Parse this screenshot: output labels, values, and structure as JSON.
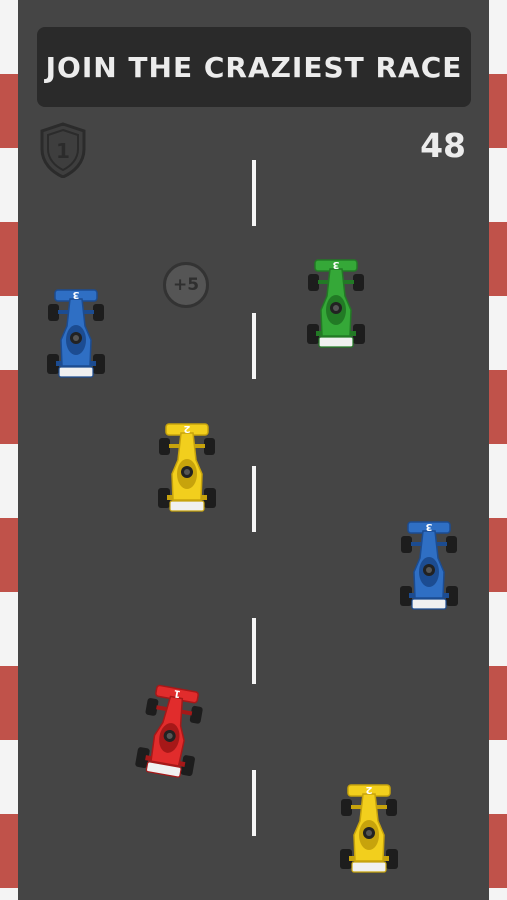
{
  "banner": {
    "text": "JOIN THE CRAZIEST RACE"
  },
  "hud": {
    "score": "48",
    "shield_label": "1",
    "bonus_label": "+5"
  },
  "colors": {
    "road": "#454545",
    "curb_red": "#c0524a",
    "curb_white": "#f4f4f4",
    "lane": "#f5f5f5"
  },
  "cars": [
    {
      "name": "blue-car-left",
      "color": "#2f6fc4",
      "dark": "#1c4c91",
      "number": "3",
      "icon": "race-car-icon"
    },
    {
      "name": "green-car",
      "color": "#35a838",
      "dark": "#227a25",
      "number": "3",
      "icon": "race-car-icon"
    },
    {
      "name": "yellow-car-middle",
      "color": "#f2cf1d",
      "dark": "#c7a30c",
      "number": "2",
      "icon": "race-car-icon"
    },
    {
      "name": "blue-car-right",
      "color": "#2f6fc4",
      "dark": "#1c4c91",
      "number": "3",
      "icon": "race-car-icon"
    },
    {
      "name": "red-car-player",
      "color": "#e12c2c",
      "dark": "#a61818",
      "number": "1",
      "icon": "race-car-icon"
    },
    {
      "name": "yellow-car-bottom",
      "color": "#f2cf1d",
      "dark": "#c7a30c",
      "number": "2",
      "icon": "race-car-icon"
    }
  ]
}
